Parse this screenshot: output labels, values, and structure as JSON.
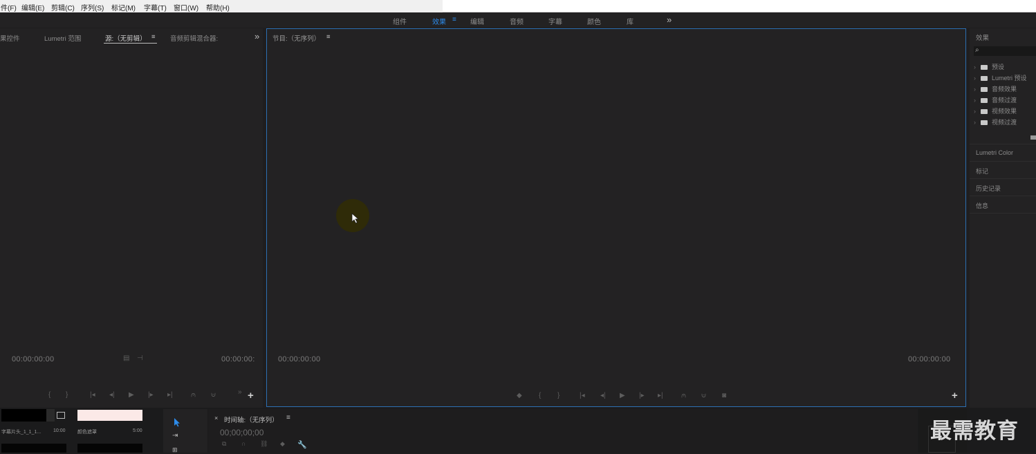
{
  "menu": [
    "件(F)",
    "编辑(E)",
    "剪辑(C)",
    "序列(S)",
    "标记(M)",
    "字幕(T)",
    "窗口(W)",
    "帮助(H)"
  ],
  "workspaces": [
    "组件",
    "效果",
    "编辑",
    "音频",
    "字幕",
    "颜色",
    "库"
  ],
  "workspace_active": "效果",
  "more_glyph": "»",
  "source_panel": {
    "tabs": [
      "果控件",
      "Lumetri 范围",
      "源:（无剪辑）",
      "音频剪辑混合器:"
    ],
    "timecode_left": "00:00:00:00",
    "timecode_right": "00:00:00:"
  },
  "program_panel": {
    "title": "节目:（无序列）",
    "timecode_left": "00:00:00:00",
    "timecode_right": "00:00:00:00"
  },
  "effects_panel": {
    "title": "效果",
    "items": [
      "预设",
      "Lumetri 预设",
      "音频效果",
      "音频过渡",
      "视频效果",
      "视频过渡"
    ],
    "sections": [
      "Lumetri Color",
      "标记",
      "历史记录",
      "信息"
    ]
  },
  "project_bin": {
    "item1_name": "字幕片头_1_1_1...",
    "item1_duration": "10:00",
    "item2_name": "颜色遮罩",
    "item2_duration": "5:00"
  },
  "timeline": {
    "title": "时间轴:（无序列）",
    "timecode": "00;00;00;00"
  },
  "watermark": "最需教育",
  "colors": {
    "accent": "#2d8ceb",
    "panel_border": "#2c6fb3",
    "background": "#1f1e1f"
  }
}
